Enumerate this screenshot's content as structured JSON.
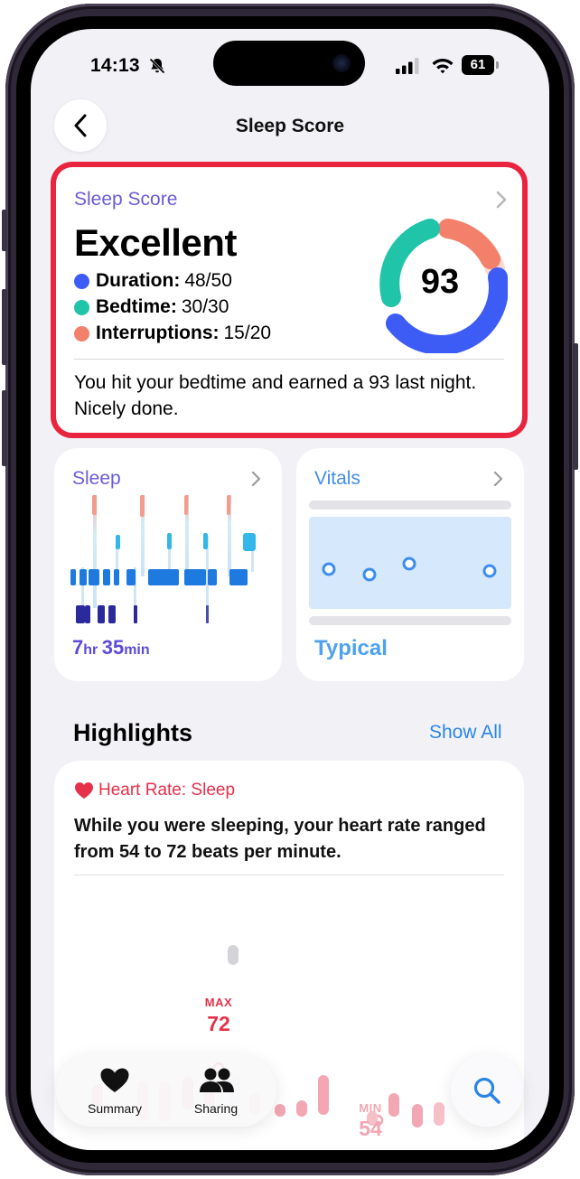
{
  "status_bar": {
    "time": "14:13",
    "battery": "61",
    "icons": [
      "bell-slash-icon",
      "signal-icon",
      "wifi-icon",
      "battery-icon"
    ]
  },
  "nav": {
    "title": "Sleep Score",
    "back_icon": "chevron-left-icon"
  },
  "score_card": {
    "title": "Sleep Score",
    "rating": "Excellent",
    "score": "93",
    "components": [
      {
        "label": "Duration:",
        "value": "48/50",
        "color": "#3d5cf5",
        "fraction": 0.96
      },
      {
        "label": "Bedtime:",
        "value": "30/30",
        "color": "#20c4a8",
        "fraction": 1.0
      },
      {
        "label": "Interruptions:",
        "value": "15/20",
        "color": "#f2806a",
        "fraction": 0.75
      }
    ],
    "message": "You hit your bedtime and earned a 93 last night. Nicely done.",
    "highlight_color": "#e8243f"
  },
  "sleep_card": {
    "title": "Sleep",
    "total_hours": "7",
    "hours_unit": "hr",
    "total_minutes": "35",
    "minutes_unit": "min"
  },
  "vitals_card": {
    "title": "Vitals",
    "status": "Typical"
  },
  "highlights": {
    "heading": "Highlights",
    "show_all": "Show All",
    "card": {
      "title": "Heart Rate: Sleep",
      "text": "While you were sleeping, your heart rate ranged from 54 to 72 beats per minute.",
      "max_label": "MAX",
      "max_value": "72",
      "min_label": "MIN",
      "min_value": "54"
    }
  },
  "tab_bar": {
    "tabs": [
      {
        "label": "Summary",
        "icon": "heart-icon"
      },
      {
        "label": "Sharing",
        "icon": "people-icon"
      }
    ],
    "search_icon": "search-icon"
  },
  "colors": {
    "accent_purple": "#6b5bdb",
    "accent_blue": "#2a85e8",
    "heart_red": "#e6304a",
    "background": "#f2f2f6"
  }
}
